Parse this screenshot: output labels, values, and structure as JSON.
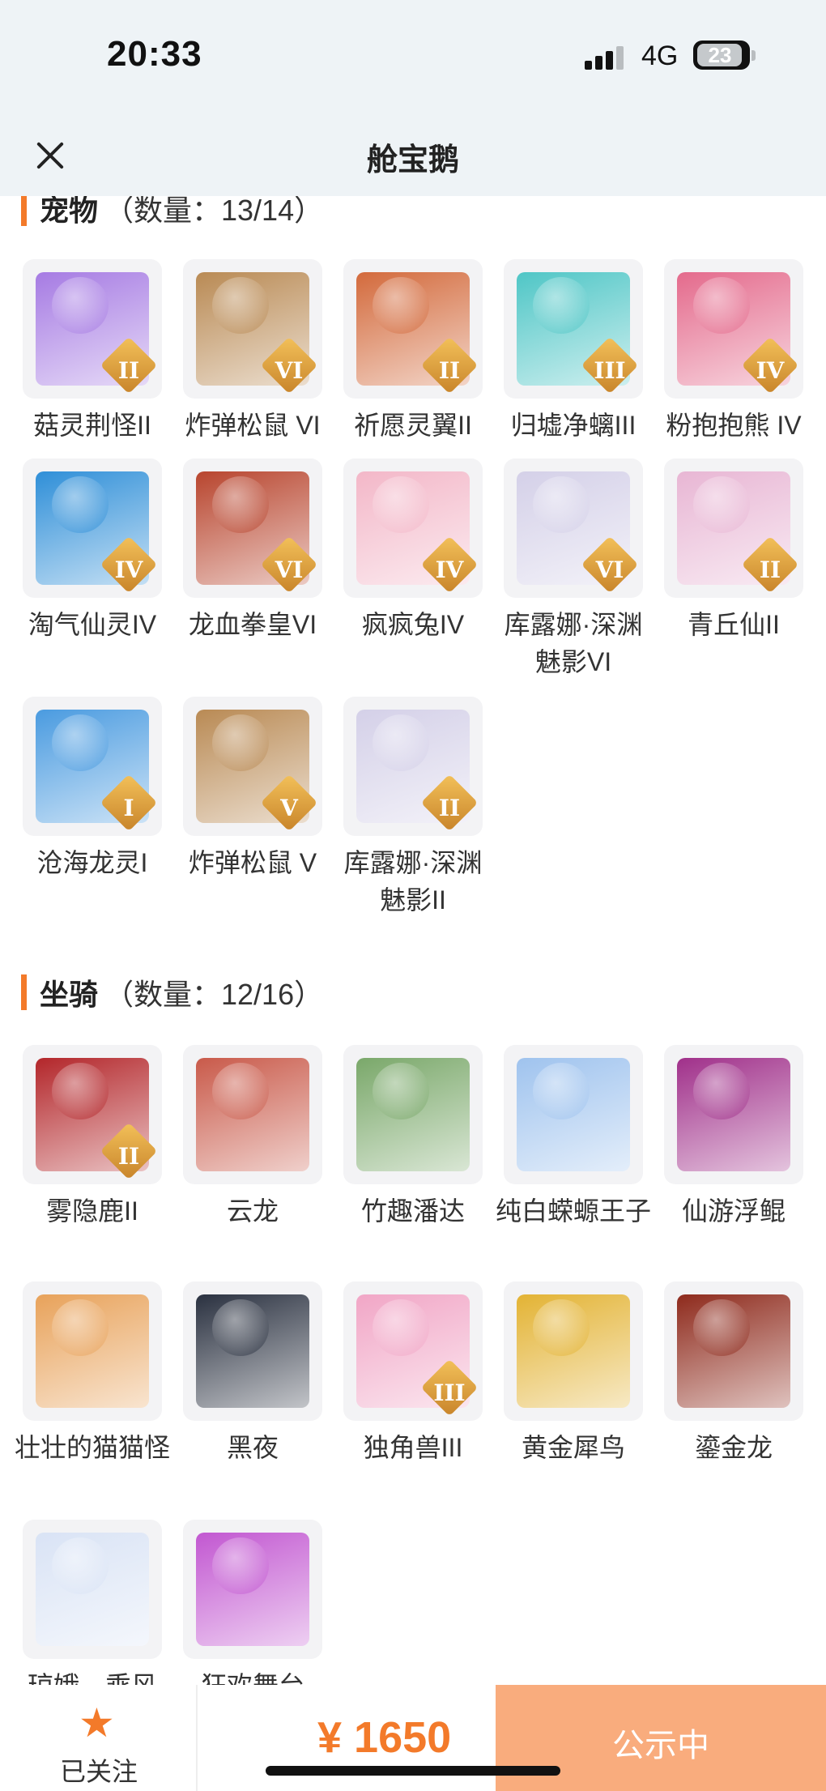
{
  "status": {
    "time": "20:33",
    "network": "4G",
    "battery": "23"
  },
  "header": {
    "title": "舱宝鹅"
  },
  "sections": [
    {
      "label": "宠物",
      "count": "（数量：13/14）",
      "items": [
        {
          "name": "菇灵荆怪II",
          "badge": "II",
          "color": "#a67be3"
        },
        {
          "name": "炸弹松鼠 VI",
          "badge": "VI",
          "color": "#b98a54"
        },
        {
          "name": "祈愿灵翼II",
          "badge": "II",
          "color": "#d36a3c"
        },
        {
          "name": "归墟净螭III",
          "badge": "III",
          "color": "#4fc6c6"
        },
        {
          "name": "粉抱抱熊 IV",
          "badge": "IV",
          "color": "#e46a8c"
        },
        {
          "name": "淘气仙灵IV",
          "badge": "IV",
          "color": "#2f8fd8"
        },
        {
          "name": "龙血拳皇VI",
          "badge": "VI",
          "color": "#b8452e"
        },
        {
          "name": "疯疯兔IV",
          "badge": "IV",
          "color": "#f3b7c8"
        },
        {
          "name": "库露娜·深渊魅影VI",
          "badge": "VI",
          "color": "#d4d0e8"
        },
        {
          "name": "青丘仙II",
          "badge": "II",
          "color": "#e8b6d4"
        },
        {
          "name": "沧海龙灵I",
          "badge": "I",
          "color": "#4a9be0"
        },
        {
          "name": "炸弹松鼠 V",
          "badge": "V",
          "color": "#b98a54"
        },
        {
          "name": "库露娜·深渊魅影II",
          "badge": "II",
          "color": "#d4d0e8"
        }
      ]
    },
    {
      "label": "坐骑",
      "count": "（数量：12/16）",
      "items": [
        {
          "name": "雾隐鹿II",
          "badge": "II",
          "color": "#b3262a"
        },
        {
          "name": "云龙",
          "badge": "",
          "color": "#c95a4a"
        },
        {
          "name": "竹趣潘达",
          "badge": "",
          "color": "#7aa86a"
        },
        {
          "name": "纯白蝾螈王子",
          "badge": "",
          "color": "#9fc3ee"
        },
        {
          "name": "仙游浮鲲",
          "badge": "",
          "color": "#a0308a"
        },
        {
          "name": "壮壮的猫猫怪",
          "badge": "",
          "color": "#e8a25a"
        },
        {
          "name": "黑夜",
          "badge": "",
          "color": "#2a3140"
        },
        {
          "name": "独角兽III",
          "badge": "III",
          "color": "#f1a6c6"
        },
        {
          "name": "黄金犀鸟",
          "badge": "",
          "color": "#e3b334"
        },
        {
          "name": "鎏金龙",
          "badge": "",
          "color": "#8e2a1c"
        },
        {
          "name": "琼娥—乘风",
          "badge": "",
          "color": "#d9e3f5"
        },
        {
          "name": "狂欢舞台",
          "badge": "",
          "color": "#c257d1"
        }
      ]
    }
  ],
  "bottom": {
    "follow_label": "已关注",
    "price": "¥ 1650",
    "action_label": "公示中"
  }
}
